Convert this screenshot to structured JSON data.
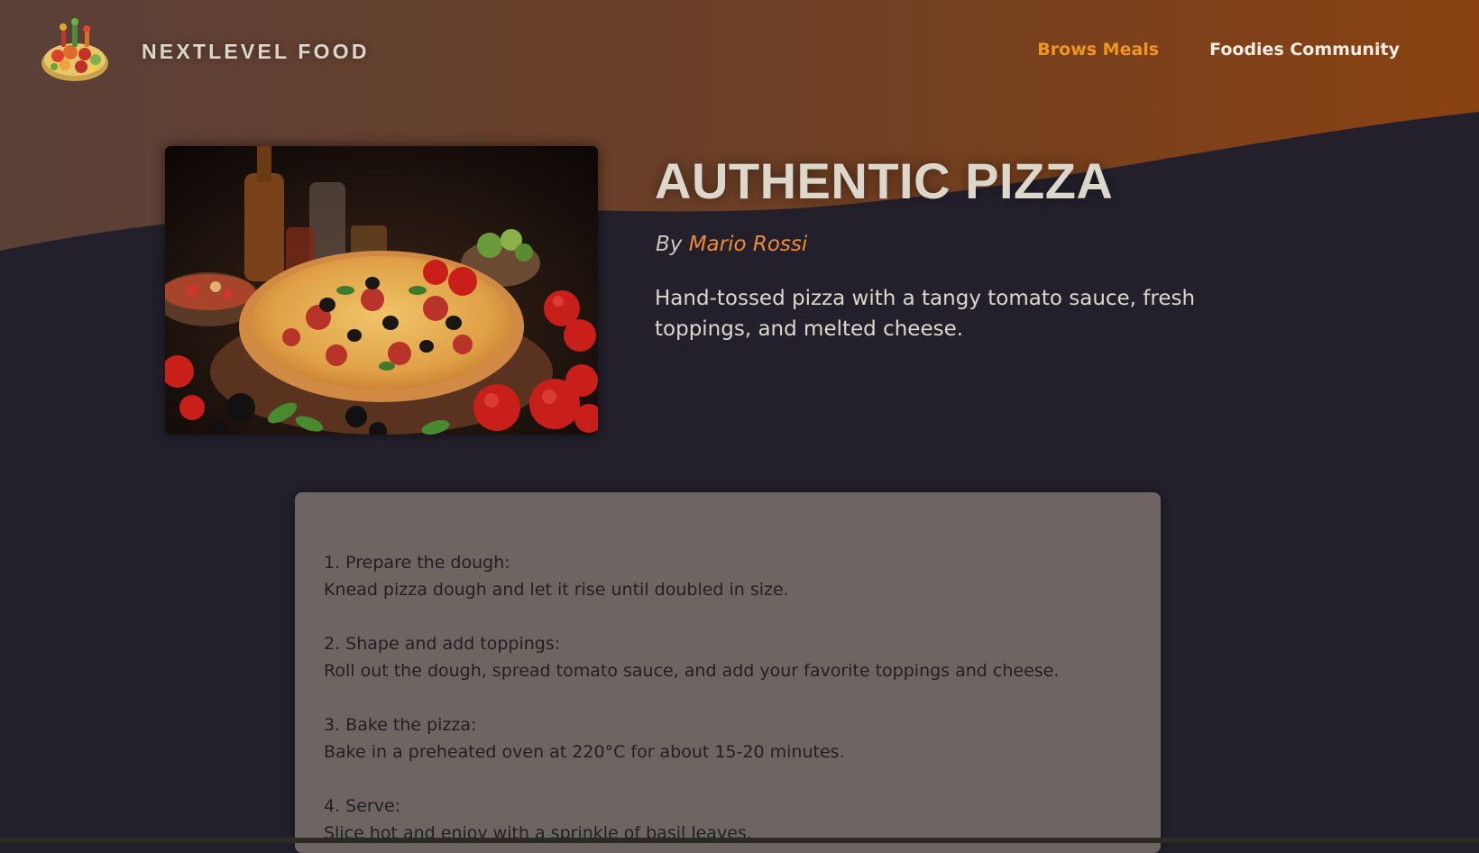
{
  "header": {
    "brand": "NextLevel Food",
    "logo_icon": "food-platter-icon",
    "nav": [
      {
        "label": "Brows Meals",
        "active": true
      },
      {
        "label": "Foodies Community",
        "active": false
      }
    ]
  },
  "meal": {
    "title": "Authentic Pizza",
    "by_prefix": "By",
    "author": "Mario Rossi",
    "summary": "Hand-tossed pizza with a tangy tomato sauce, fresh toppings, and melted cheese.",
    "image_alt": "pizza-photo",
    "steps": [
      {
        "heading": "1. Prepare the dough:",
        "text": "Knead pizza dough and let it rise until doubled in size."
      },
      {
        "heading": "2. Shape and add toppings:",
        "text": "Roll out the dough, spread tomato sauce, and add your favorite toppings and cheese."
      },
      {
        "heading": "3. Bake the pizza:",
        "text": "Bake in a preheated oven at 220°C for about 15-20 minutes."
      },
      {
        "heading": "4. Serve:",
        "text": "Slice hot and enjoy with a sprinkle of basil leaves."
      }
    ]
  },
  "colors": {
    "background": "#23202c",
    "header_gradient_start": "#5a4038",
    "header_gradient_end": "#8a4212",
    "accent": "#f0961f",
    "author": "#f08a3a",
    "instructions_bg": "#6e6563"
  }
}
